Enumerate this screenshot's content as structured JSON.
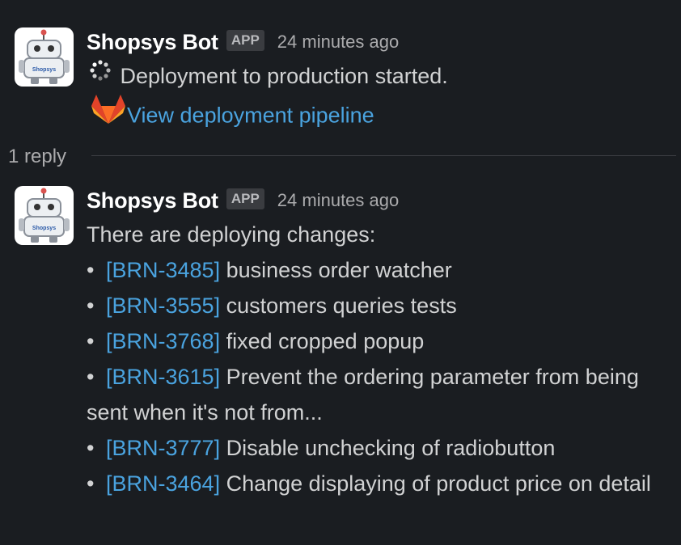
{
  "messages": [
    {
      "sender": "Shopsys Bot",
      "badge": "APP",
      "timestamp": "24 minutes ago",
      "avatar_text": "Shopsys",
      "status_icon": "loading-spinner-icon",
      "status_text": "Deployment to production started.",
      "pipeline_icon": "gitlab-icon",
      "pipeline_link": "View deployment pipeline"
    },
    {
      "sender": "Shopsys Bot",
      "badge": "APP",
      "timestamp": "24 minutes ago",
      "avatar_text": "Shopsys",
      "intro": "There are deploying changes:",
      "changes": [
        {
          "id": "[BRN-3485]",
          "text": "business order watcher"
        },
        {
          "id": "[BRN-3555]",
          "text": "customers queries tests"
        },
        {
          "id": "[BRN-3768]",
          "text": "fixed cropped popup"
        },
        {
          "id": "[BRN-3615]",
          "text": "Prevent the ordering parameter from being sent when it's not from..."
        },
        {
          "id": "[BRN-3777]",
          "text": "Disable unchecking of radiobutton"
        },
        {
          "id": "[BRN-3464]",
          "text": "Change displaying of product price on detail"
        }
      ]
    }
  ],
  "thread": {
    "reply_count": "1 reply"
  },
  "colors": {
    "background": "#1a1d21",
    "link": "#4aa3df",
    "text": "#d1d2d3",
    "gitlab_orange": "#fc6d26"
  }
}
